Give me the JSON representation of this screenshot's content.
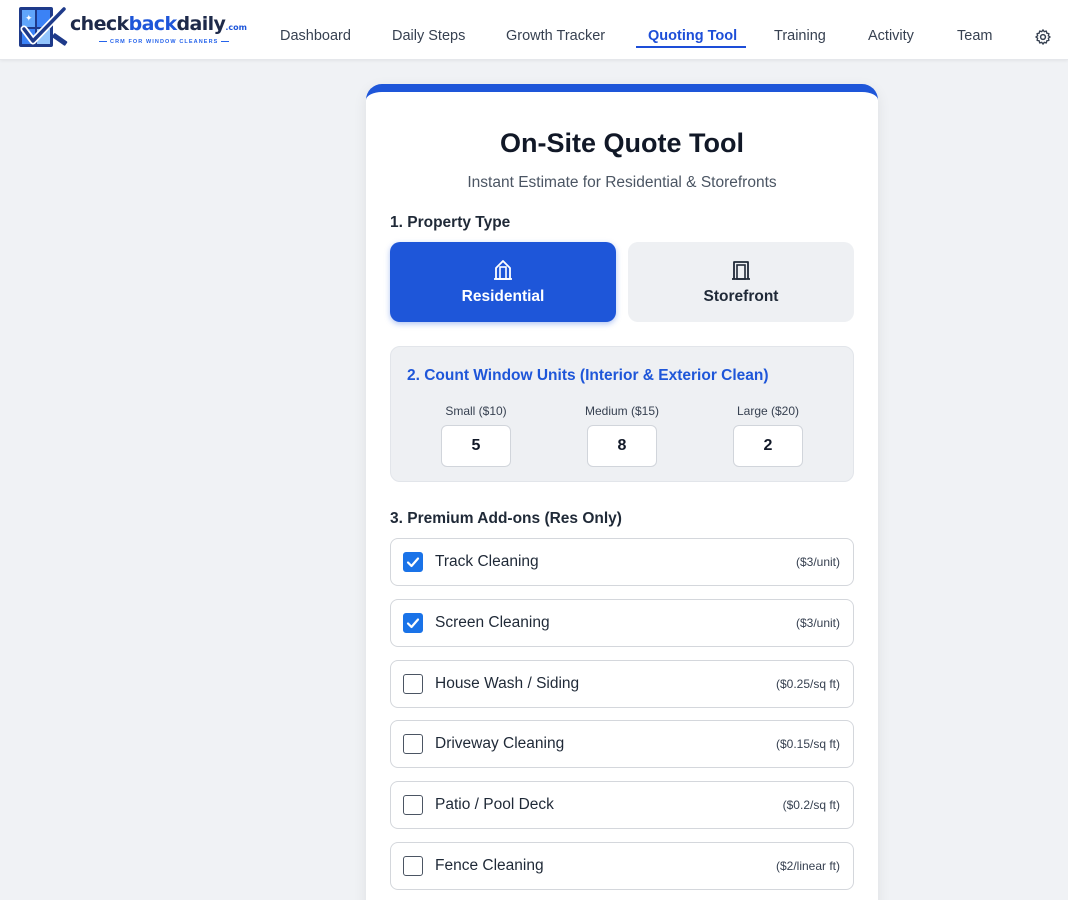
{
  "header": {
    "logo": {
      "brand_dark": "check",
      "brand_blue": "back",
      "brand_dark2": "daily",
      "domain_suffix": ".com",
      "tagline": "CRM FOR WINDOW CLEANERS"
    },
    "nav": [
      {
        "label": "Dashboard",
        "active": false
      },
      {
        "label": "Daily Steps",
        "active": false
      },
      {
        "label": "Growth Tracker",
        "active": false
      },
      {
        "label": "Quoting Tool",
        "active": true
      },
      {
        "label": "Training",
        "active": false
      },
      {
        "label": "Activity",
        "active": false
      },
      {
        "label": "Team",
        "active": false
      }
    ],
    "settings_icon": "gear-icon"
  },
  "card": {
    "title": "On-Site Quote Tool",
    "subtitle": "Instant Estimate for Residential & Storefronts",
    "accent_color": "#1e56d9",
    "property_type": {
      "label": "1. Property Type",
      "options": [
        {
          "label": "Residential",
          "icon": "house-icon",
          "selected": true
        },
        {
          "label": "Storefront",
          "icon": "storefront-icon",
          "selected": false
        }
      ]
    },
    "window_units": {
      "label": "2. Count Window Units (Interior & Exterior Clean)",
      "units": [
        {
          "label": "Small ($10)",
          "value": "5"
        },
        {
          "label": "Medium ($15)",
          "value": "8"
        },
        {
          "label": "Large ($20)",
          "value": "2"
        }
      ]
    },
    "addons": {
      "label": "3. Premium Add-ons (Res Only)",
      "items": [
        {
          "name": "Track Cleaning",
          "price": "($3/unit)",
          "checked": true
        },
        {
          "name": "Screen Cleaning",
          "price": "($3/unit)",
          "checked": true
        },
        {
          "name": "House Wash / Siding",
          "price": "($0.25/sq ft)",
          "checked": false
        },
        {
          "name": "Driveway Cleaning",
          "price": "($0.15/sq ft)",
          "checked": false
        },
        {
          "name": "Patio / Pool Deck",
          "price": "($0.2/sq ft)",
          "checked": false
        },
        {
          "name": "Fence Cleaning",
          "price": "($2/linear ft)",
          "checked": false
        }
      ]
    }
  }
}
